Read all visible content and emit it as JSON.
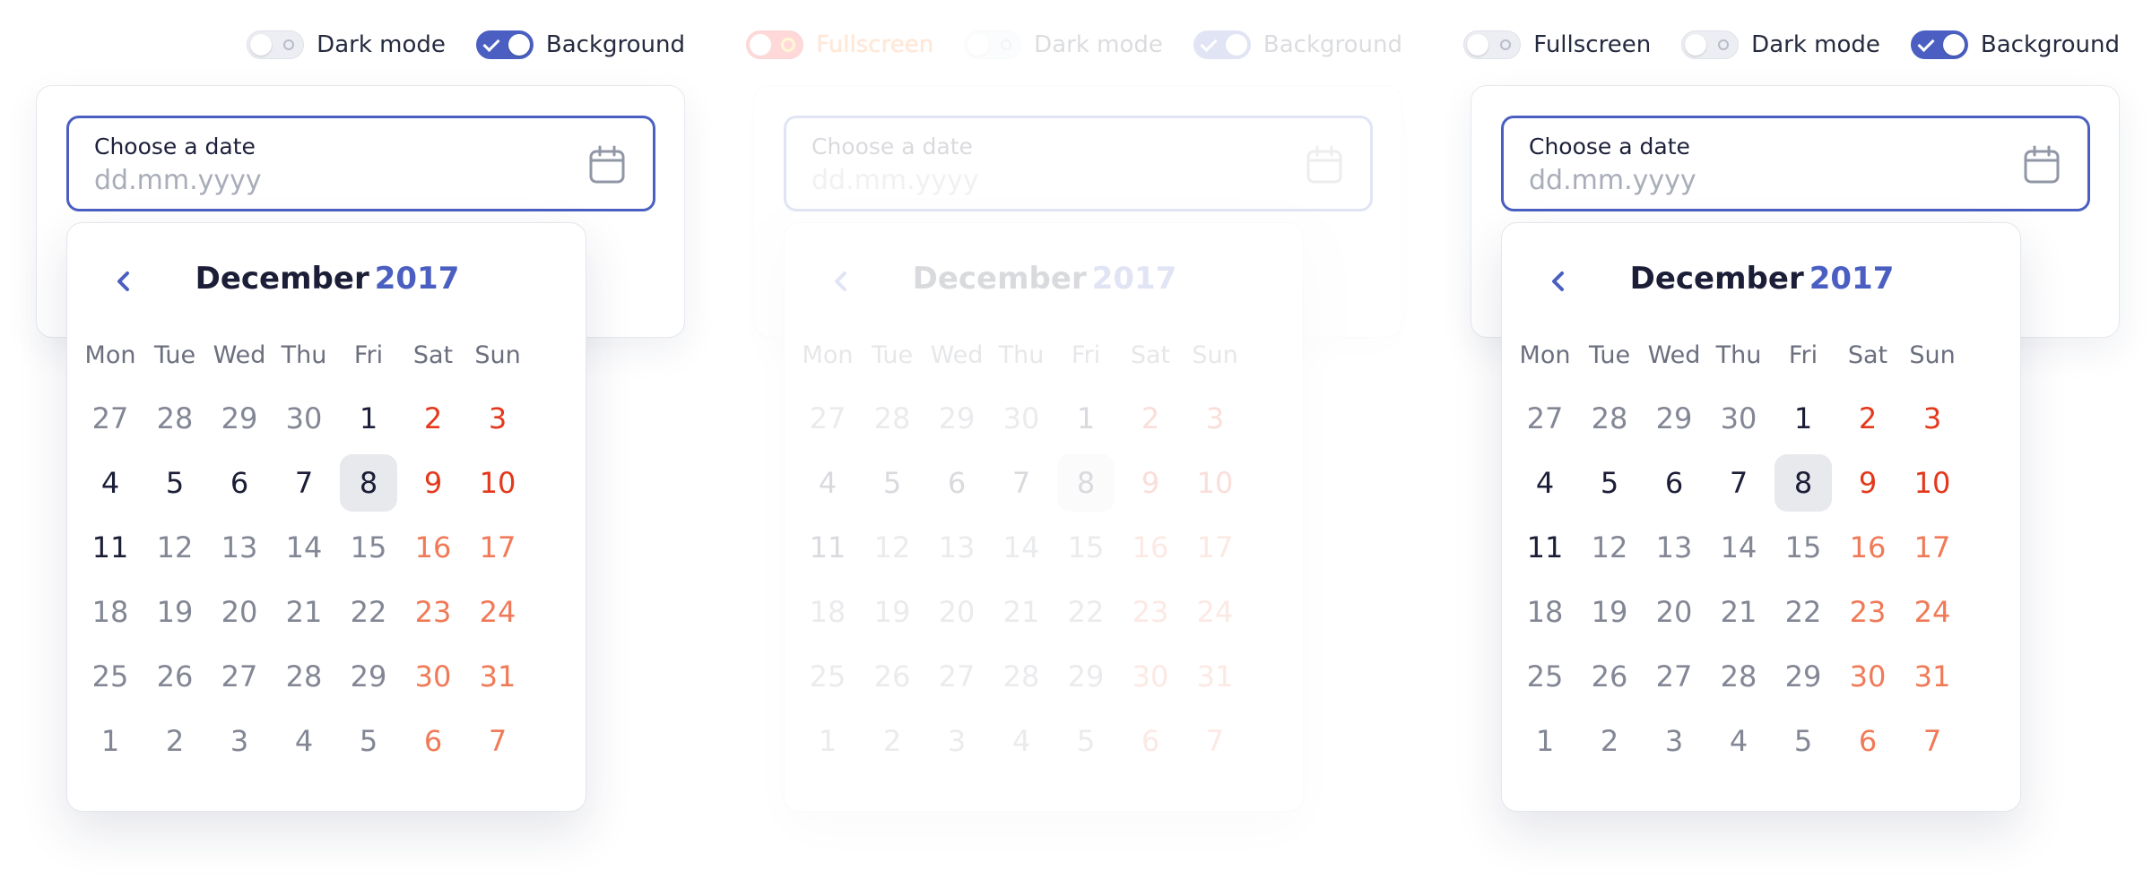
{
  "variants": [
    {
      "toggles": [
        {
          "label": "Dark mode",
          "state": "off"
        },
        {
          "label": "Background",
          "state": "on"
        }
      ],
      "field": {
        "label": "Choose a date",
        "placeholder": "dd.mm.yyyy"
      },
      "calendar": {
        "month": "December",
        "year": "2017",
        "weekdays": [
          "Mon",
          "Tue",
          "Wed",
          "Thu",
          "Fri",
          "Sat",
          "Sun"
        ],
        "days": [
          {
            "d": "27",
            "c": "dim"
          },
          {
            "d": "28",
            "c": "dim"
          },
          {
            "d": "29",
            "c": "dim"
          },
          {
            "d": "30",
            "c": "dim"
          },
          {
            "d": "1",
            "c": "strong"
          },
          {
            "d": "2",
            "c": "red"
          },
          {
            "d": "3",
            "c": "red"
          },
          {
            "d": "4",
            "c": "strong"
          },
          {
            "d": "5",
            "c": "strong"
          },
          {
            "d": "6",
            "c": "strong"
          },
          {
            "d": "7",
            "c": "strong"
          },
          {
            "d": "8",
            "c": "strong",
            "selected": true
          },
          {
            "d": "9",
            "c": "red"
          },
          {
            "d": "10",
            "c": "red"
          },
          {
            "d": "11",
            "c": "strong"
          },
          {
            "d": "12",
            "c": "dim"
          },
          {
            "d": "13",
            "c": "dim"
          },
          {
            "d": "14",
            "c": "dim"
          },
          {
            "d": "15",
            "c": "dim"
          },
          {
            "d": "16",
            "c": "orange"
          },
          {
            "d": "17",
            "c": "orange"
          },
          {
            "d": "18",
            "c": "dim"
          },
          {
            "d": "19",
            "c": "dim"
          },
          {
            "d": "20",
            "c": "dim"
          },
          {
            "d": "21",
            "c": "dim"
          },
          {
            "d": "22",
            "c": "dim"
          },
          {
            "d": "23",
            "c": "orange"
          },
          {
            "d": "24",
            "c": "orange"
          },
          {
            "d": "25",
            "c": "dim"
          },
          {
            "d": "26",
            "c": "dim"
          },
          {
            "d": "27",
            "c": "dim"
          },
          {
            "d": "28",
            "c": "dim"
          },
          {
            "d": "29",
            "c": "dim"
          },
          {
            "d": "30",
            "c": "orange"
          },
          {
            "d": "31",
            "c": "orange"
          },
          {
            "d": "1",
            "c": "dim"
          },
          {
            "d": "2",
            "c": "dim"
          },
          {
            "d": "3",
            "c": "dim"
          },
          {
            "d": "4",
            "c": "dim"
          },
          {
            "d": "5",
            "c": "dim"
          },
          {
            "d": "6",
            "c": "orange"
          },
          {
            "d": "7",
            "c": "orange"
          }
        ]
      }
    },
    {
      "toggles": [
        {
          "label": "Fullscreen",
          "state": "alert"
        },
        {
          "label": "Dark mode",
          "state": "off"
        },
        {
          "label": "Background",
          "state": "on"
        }
      ],
      "field": {
        "label": "Choose a date",
        "placeholder": "dd.mm.yyyy"
      },
      "calendar": {
        "month": "December",
        "year": "2017",
        "weekdays": [
          "Mon",
          "Tue",
          "Wed",
          "Thu",
          "Fri",
          "Sat",
          "Sun"
        ],
        "days": [
          {
            "d": "27",
            "c": "dim"
          },
          {
            "d": "28",
            "c": "dim"
          },
          {
            "d": "29",
            "c": "dim"
          },
          {
            "d": "30",
            "c": "dim"
          },
          {
            "d": "1",
            "c": "strong"
          },
          {
            "d": "2",
            "c": "red"
          },
          {
            "d": "3",
            "c": "red"
          },
          {
            "d": "4",
            "c": "strong"
          },
          {
            "d": "5",
            "c": "strong"
          },
          {
            "d": "6",
            "c": "strong"
          },
          {
            "d": "7",
            "c": "strong"
          },
          {
            "d": "8",
            "c": "strong",
            "selected": true
          },
          {
            "d": "9",
            "c": "red"
          },
          {
            "d": "10",
            "c": "red"
          },
          {
            "d": "11",
            "c": "strong"
          },
          {
            "d": "12",
            "c": "dim"
          },
          {
            "d": "13",
            "c": "dim"
          },
          {
            "d": "14",
            "c": "dim"
          },
          {
            "d": "15",
            "c": "dim"
          },
          {
            "d": "16",
            "c": "orange"
          },
          {
            "d": "17",
            "c": "orange"
          },
          {
            "d": "18",
            "c": "dim"
          },
          {
            "d": "19",
            "c": "dim"
          },
          {
            "d": "20",
            "c": "dim"
          },
          {
            "d": "21",
            "c": "dim"
          },
          {
            "d": "22",
            "c": "dim"
          },
          {
            "d": "23",
            "c": "orange"
          },
          {
            "d": "24",
            "c": "orange"
          },
          {
            "d": "25",
            "c": "dim"
          },
          {
            "d": "26",
            "c": "dim"
          },
          {
            "d": "27",
            "c": "dim"
          },
          {
            "d": "28",
            "c": "dim"
          },
          {
            "d": "29",
            "c": "dim"
          },
          {
            "d": "30",
            "c": "orange"
          },
          {
            "d": "31",
            "c": "orange"
          },
          {
            "d": "1",
            "c": "dim"
          },
          {
            "d": "2",
            "c": "dim"
          },
          {
            "d": "3",
            "c": "dim"
          },
          {
            "d": "4",
            "c": "dim"
          },
          {
            "d": "5",
            "c": "dim"
          },
          {
            "d": "6",
            "c": "orange"
          },
          {
            "d": "7",
            "c": "orange"
          }
        ]
      }
    },
    {
      "toggles": [
        {
          "label": "Fullscreen",
          "state": "off"
        },
        {
          "label": "Dark mode",
          "state": "off"
        },
        {
          "label": "Background",
          "state": "on"
        }
      ],
      "field": {
        "label": "Choose a date",
        "placeholder": "dd.mm.yyyy"
      },
      "calendar": {
        "month": "December",
        "year": "2017",
        "weekdays": [
          "Mon",
          "Tue",
          "Wed",
          "Thu",
          "Fri",
          "Sat",
          "Sun"
        ],
        "days": [
          {
            "d": "27",
            "c": "dim"
          },
          {
            "d": "28",
            "c": "dim"
          },
          {
            "d": "29",
            "c": "dim"
          },
          {
            "d": "30",
            "c": "dim"
          },
          {
            "d": "1",
            "c": "strong"
          },
          {
            "d": "2",
            "c": "red"
          },
          {
            "d": "3",
            "c": "red"
          },
          {
            "d": "4",
            "c": "strong"
          },
          {
            "d": "5",
            "c": "strong"
          },
          {
            "d": "6",
            "c": "strong"
          },
          {
            "d": "7",
            "c": "strong"
          },
          {
            "d": "8",
            "c": "strong",
            "selected": true
          },
          {
            "d": "9",
            "c": "red"
          },
          {
            "d": "10",
            "c": "red"
          },
          {
            "d": "11",
            "c": "strong"
          },
          {
            "d": "12",
            "c": "dim"
          },
          {
            "d": "13",
            "c": "dim"
          },
          {
            "d": "14",
            "c": "dim"
          },
          {
            "d": "15",
            "c": "dim"
          },
          {
            "d": "16",
            "c": "orange"
          },
          {
            "d": "17",
            "c": "orange"
          },
          {
            "d": "18",
            "c": "dim"
          },
          {
            "d": "19",
            "c": "dim"
          },
          {
            "d": "20",
            "c": "dim"
          },
          {
            "d": "21",
            "c": "dim"
          },
          {
            "d": "22",
            "c": "dim"
          },
          {
            "d": "23",
            "c": "orange"
          },
          {
            "d": "24",
            "c": "orange"
          },
          {
            "d": "25",
            "c": "dim"
          },
          {
            "d": "26",
            "c": "dim"
          },
          {
            "d": "27",
            "c": "dim"
          },
          {
            "d": "28",
            "c": "dim"
          },
          {
            "d": "29",
            "c": "dim"
          },
          {
            "d": "30",
            "c": "orange"
          },
          {
            "d": "31",
            "c": "orange"
          },
          {
            "d": "1",
            "c": "dim"
          },
          {
            "d": "2",
            "c": "dim"
          },
          {
            "d": "3",
            "c": "dim"
          },
          {
            "d": "4",
            "c": "dim"
          },
          {
            "d": "5",
            "c": "dim"
          },
          {
            "d": "6",
            "c": "orange"
          },
          {
            "d": "7",
            "c": "orange"
          }
        ]
      }
    }
  ],
  "colors": {
    "accent": "#4a5fc1",
    "weekend_current": "#e4381c",
    "weekend_other": "#f07a58",
    "alert_toggle": "#ff1d1d"
  },
  "icons": {
    "calendar": "calendar-icon",
    "prev": "chevron-left-icon",
    "check": "check-icon"
  }
}
